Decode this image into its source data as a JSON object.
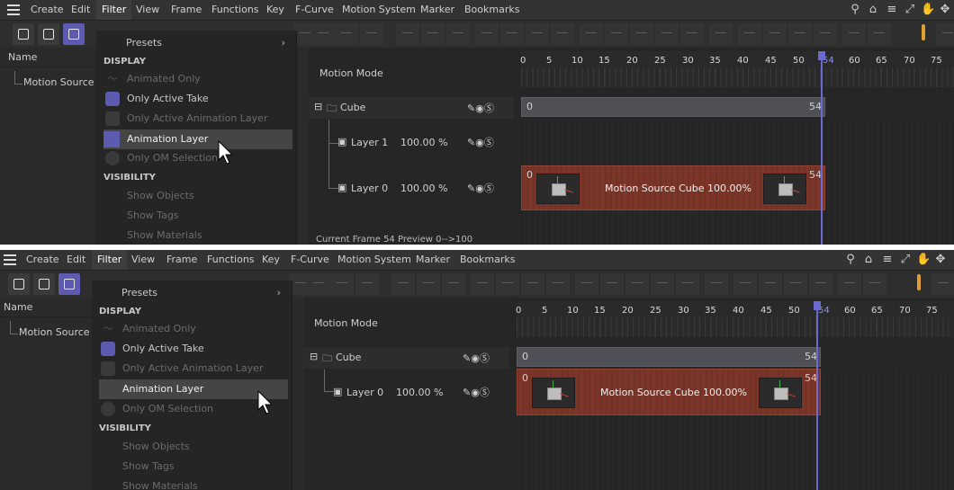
{
  "menu": [
    "Create",
    "Edit",
    "Filter",
    "View",
    "Frame",
    "Functions",
    "Key",
    "F-Curve",
    "Motion System",
    "Marker",
    "Bookmarks"
  ],
  "active_menu": "Filter",
  "left_panel": {
    "header": "Name",
    "item": "Motion Source C"
  },
  "dropdown": {
    "presets": "Presets",
    "display_heading": "DISPLAY",
    "display_items": [
      "Animated Only",
      "Only Active Take",
      "Only Active Animation Layer",
      "Animation Layer",
      "Only OM Selection"
    ],
    "visibility_heading": "VISIBILITY",
    "visibility_items": [
      "Show Objects",
      "Show Tags",
      "Show Materials"
    ]
  },
  "timeline": {
    "motion_mode": "Motion Mode",
    "ruler": [
      "0",
      "5",
      "10",
      "15",
      "20",
      "25",
      "30",
      "35",
      "40",
      "45",
      "50",
      "54",
      "60",
      "65",
      "70",
      "75"
    ],
    "current_frame_marker": "54",
    "object": "Cube",
    "top_layers": [
      {
        "name": "Layer 1",
        "weight": "100.00 %"
      },
      {
        "name": "Layer 0",
        "weight": "100.00 %"
      }
    ],
    "bottom_layers": [
      {
        "name": "Layer 0",
        "weight": "100.00 %"
      }
    ],
    "bar_start": "0",
    "bar_end": "54",
    "clip_label": "Motion Source Cube  100.00%",
    "status": "Current Frame  54   Preview  0-->100"
  },
  "colors": {
    "accent": "#5d5bb0",
    "clip": "#7a3528",
    "playhead": "#6a6ad0"
  }
}
